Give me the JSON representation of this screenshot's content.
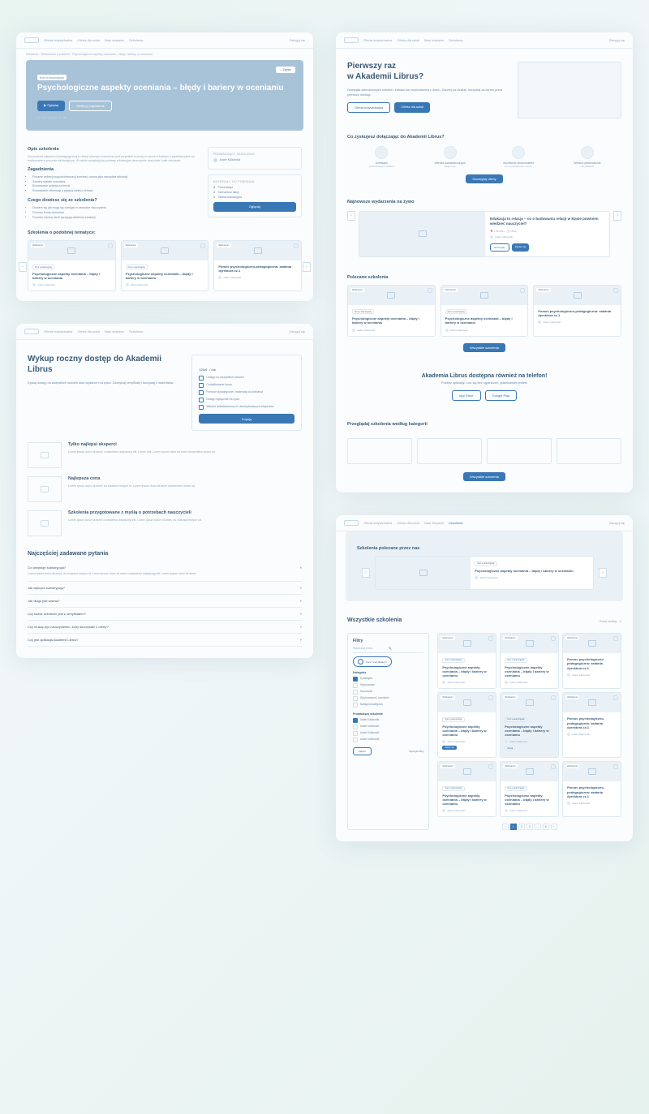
{
  "nav": {
    "items": [
      "Oferta indywidualna",
      "Oferta dla szkół",
      "Nasi eksperci",
      "Szkolenia"
    ],
    "login": "Zaloguj się"
  },
  "breadcrumb": "Szkolenia › Webinarium w pakiecie › Psychologiczne aspekty oceniania – błędy i bariery w ocenianiu",
  "s1": {
    "save": "☆ Zapisz",
    "badge": "Kurs e-learningowy",
    "title": "Psychologiczne aspekty oceniania – błędy i bariery w ocenianiu",
    "btn_watch": "▶ Oglądaj",
    "btn_preview": "Obejrzyj zapowiedź",
    "time": "⏱ Czas trwania: 40 min",
    "desc_h": "Opis szkolenia",
    "desc": "Zrozumienie własnej roli pedagogicznej w relacji własnym rozumieniu jest przydatne w pracy w szkole w każdym z aspektów jakie są realizowane w procesie edukacyjnym. W szkole spotykają się postawy edukacyjne nauczyciele uczniowie i całe otoczenie.",
    "zag_h": "Zagadnienia",
    "zag": [
      "Podanie definicji pojęcia informacji zwrotnej i ocena jako narzędzie edukacji",
      "Szkolny system oceniania",
      "Rozważanie pytania na temat",
      "Rozważanie informacji a pytania widelcu tematu"
    ],
    "learn_h": "Czego dowiesz się ze szkolenia?",
    "learn": [
      "Dowiem się jak mogę się rozwijać w zawodzie nauczyciela",
      "Poznam formy oceniania",
      "Poznam różnicę które sprzyjają obiektom edukacji"
    ],
    "box1_h": "Prowadzący szkolenie",
    "box1_auth": "Adam Kalkowski",
    "box2_h": "Materiały do pobrania",
    "box2_items": [
      "Prezentacja",
      "Scenariusz lekcji",
      "Tablica edukacyjna"
    ],
    "box2_btn": "Oglądaj",
    "rel_h": "Szkolenia o podobnej tematyce:",
    "cards": [
      {
        "tag": "Webinarium",
        "badge": "Kurs e-learningowy",
        "title": "Psychologiczne aspekty oceniania – błędy i bariery w ocenianiu",
        "auth": "Adam Kalkowski"
      },
      {
        "tag": "Webinarium",
        "badge": "Kurs e-learningowy",
        "title": "Psychologiczne aspekty oceniania – błędy i bariery w ocenianiu",
        "auth": "Adam Kalkowski"
      },
      {
        "tag": "Webinarium",
        "badge": "",
        "title": "Pomoc psychologiczno-pedagogiczna: zadania dyrektora cz.1",
        "auth": "Adam Kalkowski"
      }
    ]
  },
  "s2": {
    "hero_h": "Pierwszy raz\nw Akademii Librus?",
    "hero_p": "Dziesiątki wartościowych szkoleń i kursów bez wychodzenia z domu. Zacznij już dzisiaj i korzystaj za darmo przez pierwszy miesiąc.",
    "b1": "Oferta indywidualna",
    "b2": "Oferta dla szkół",
    "benefits_h": "Co zyskujesz dołączając do Akademii Librus?",
    "benefits": [
      {
        "t": "Dziesiątki",
        "s": "wartościowych szkoleń"
      },
      {
        "t": "Wiedza doświadczonych",
        "s": "ekspertów"
      },
      {
        "t": "Możliwość doskonalenia",
        "s": "bez wychodzenia z domu"
      },
      {
        "t": "Wiedza potwierdzona",
        "s": "certyfikatami"
      }
    ],
    "details": "Szczegóły oferty",
    "events_h": "Najnowsze wydarzenia na żywo",
    "event": {
      "title": "Edukacja to relacja – co o budowaniu relacji w klasie powinien wiedzieć nauczyciel?",
      "date": "📅 1.06.2021",
      "time": "🕐 18:00",
      "auth": "Adam Kalkowski",
      "b1": "Szczegóły",
      "b2": "Zapisz się"
    },
    "rec_h": "Polecane szkolenia",
    "cards": [
      {
        "badge": "Kurs e-learningowy",
        "title": "Psychologiczne aspekty oceniania – błędy i bariery w ocenianiu",
        "auth": "Adam Kalkowski"
      },
      {
        "badge": "Kurs e-learningowy",
        "title": "Psychologiczne aspekty oceniania – błędy i bariery w ocenianiu",
        "auth": "Adam Kalkowski"
      },
      {
        "badge": "",
        "title": "Pomoc psychologiczno-pedagogiczna: zadania dyrektora cz.1",
        "auth": "Adam Kalkowski"
      }
    ],
    "all": "Wszystkie szkolenia",
    "app_h": "Akademia Librus dostępna również na telefon!",
    "app_p": "Pobierz aplikację i ucz się bez ograniczeń, gdziekolwiek jesteś!",
    "app_b1": "App Store",
    "app_b2": "Google Play",
    "cats_h": "Przeglądaj szkolenia według kategorii"
  },
  "s3": {
    "h": "Wykup roczny dostęp do Akademii Librus",
    "p": "Zyskaj dostęp do wszystkich szkoleń oraz wydarzeń na żywo. Zdobywaj certyfikaty i korzystaj z materiałów.",
    "price": "120zł",
    "per": "/ rok",
    "feat": [
      "Dostęp do wszystkich szkoleń",
      "Certyfikowane kursy",
      "Pomoce dydaktyczne i materiały do pobrania",
      "Dostęp wyłącznie na żywo",
      "Wiedza doświadczonych i akredytowanych ekspertów"
    ],
    "buy": "Kupuję",
    "blocks": [
      {
        "h": "Tylko najlepsi eksperci",
        "p": "Lorem ipsum dolor sit amet, consectetur adipiscing elit. Lorem elitr. Lorem ipsum dolor sit amet consectetur donec sit."
      },
      {
        "h": "Najlepsza cena",
        "p": "Lorem ipsum dolor sit amet, do eiusmod tempor id. Lorem ipsum dolor sit amet consectetur donec sit."
      },
      {
        "h": "Szkolenia przygotowane z myślą o potrzebach nauczycieli",
        "p": "Lorem ipsum dolor sit amet consectetur adipiscing elit. Lorem ipsum dolor sit amet, do eiusmod tempor sit."
      }
    ],
    "faq_h": "Najczęściej zadawane pytania",
    "faq": [
      {
        "q": "Co obejmuje subskrypcja?",
        "a": "Lorem ipsum dolor sit amet, do eiusmod tempor id. Lorem ipsum dolor sit amet consectetur adipiscing elit. Lorem ipsum dolor sit amet."
      },
      {
        "q": "Jak wykupić subskrypcję?"
      },
      {
        "q": "Jak długo jest ważna?"
      },
      {
        "q": "Czy każde szkolenie jest z certyfikatem?"
      },
      {
        "q": "Czy muszę być nauczycielem, żeby skorzystać z oferty?"
      },
      {
        "q": "Czy jest aplikacja Akademii Librus?"
      }
    ]
  },
  "s4": {
    "rec_h": "Szkolenia polecane przez nas",
    "rec_card": {
      "badge": "Kurs e-learningowy",
      "title": "Psychologiczne aspekty oceniania – błędy i bariery w ocenianiu",
      "auth": "Adam Kalkowski"
    },
    "all_h": "Wszystkie szkolenia",
    "sort_l": "Sortuj według",
    "sort_v": "▾",
    "flt_h": "Filtry",
    "search_ph": "Wyszukaj kursu",
    "pill": "Kurs z certyfikatem",
    "cat_h": "Kategoria",
    "cats": [
      "Dydaktyka",
      "Wychowanie",
      "Nauczanie",
      "Wychowawca i ocenianie",
      "Następna kategoria"
    ],
    "auth_h": "Prowadzący szkolenie",
    "auths": [
      "Adam Kalkowski",
      "Adam Kalkowski",
      "Adam Kalkowski",
      "Adam Kalkowski"
    ],
    "apply": "Zapisz",
    "clear": "Wyczyść filtry",
    "grid": [
      {
        "title": "Psychologiczne aspekty oceniania – błędy i bariery w ocenianiu",
        "auth": "Adam Kalkowski",
        "badge": "Kurs e-learningowy"
      },
      {
        "title": "Psychologiczne aspekty oceniania – błędy i bariery w ocenianiu",
        "auth": "Adam Kalkowski",
        "badge": "Kurs e-learningowy"
      },
      {
        "title": "Pomoc psychologiczno-pedagogiczna: zadania dyrektora cz.1",
        "auth": "Adam Kalkowski",
        "badge": ""
      },
      {
        "title": "Psychologiczne aspekty oceniania – błędy i bariery w ocenianiu",
        "auth": "Adam Kalkowski",
        "badge": "Kurs e-learningowy",
        "special": "Zapisz się"
      },
      {
        "title": "Psychologiczne aspekty oceniania – błędy i bariery w ocenianiu",
        "auth": "Adam Kalkowski",
        "badge": "Kurs e-learningowy",
        "offer": "Oferta"
      },
      {
        "title": "Pomoc psychologiczno-pedagogiczna: zadania dyrektora cz.1",
        "auth": "Adam Kalkowski",
        "badge": ""
      },
      {
        "title": "Psychologiczne aspekty oceniania – błędy i bariery w ocenianiu",
        "auth": "Adam Kalkowski",
        "badge": "Kurs e-learningowy"
      },
      {
        "title": "Psychologiczne aspekty oceniania – błędy i bariery w ocenianiu",
        "auth": "Adam Kalkowski",
        "badge": "Kurs e-learningowy"
      },
      {
        "title": "Pomoc psychologiczno-pedagogiczna: zadania dyrektora cz.1",
        "auth": "Adam Kalkowski",
        "badge": ""
      }
    ],
    "pages": [
      "‹",
      "1",
      "2",
      "3",
      "...",
      "8",
      "›"
    ]
  }
}
